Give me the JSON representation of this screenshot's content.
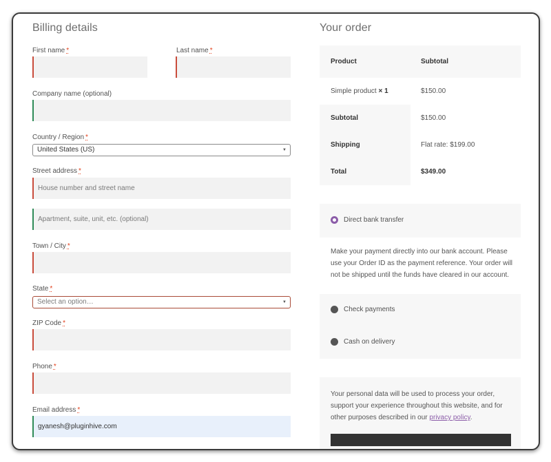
{
  "billing": {
    "heading": "Billing details",
    "required_mark": "*",
    "first_name_label": "First name",
    "last_name_label": "Last name",
    "company_label": "Company name (optional)",
    "country_label": "Country / Region",
    "country_value": "United States (US)",
    "street_label": "Street address",
    "street_placeholder": "House number and street name",
    "apartment_placeholder": "Apartment, suite, unit, etc. (optional)",
    "city_label": "Town / City",
    "state_label": "State",
    "state_placeholder": "Select an option…",
    "zip_label": "ZIP Code",
    "phone_label": "Phone",
    "email_label": "Email address",
    "email_value": "gyanesh@pluginhive.com"
  },
  "order": {
    "heading": "Your order",
    "col_product": "Product",
    "col_subtotal": "Subtotal",
    "item_name": "Simple product",
    "item_qty": "× 1",
    "item_price": "$150.00",
    "subtotal_label": "Subtotal",
    "subtotal_value": "$150.00",
    "shipping_label": "Shipping",
    "shipping_value": "Flat rate: $199.00",
    "total_label": "Total",
    "total_value": "$349.00"
  },
  "payment": {
    "options": [
      "Direct bank transfer",
      "Check payments",
      "Cash on delivery"
    ],
    "selected": "Direct bank transfer",
    "description": "Make your payment directly into our bank account. Please use your Order ID as the payment reference. Your order will not be shipped until the funds have cleared in our account."
  },
  "privacy": {
    "text_before": "Your personal data will be used to process your order, support your experience throughout this website, and for other purposes described in our ",
    "link_text": "privacy policy",
    "text_after": "."
  },
  "colors": {
    "accent": "#8b5ca8",
    "required": "#e2401c",
    "invalid_border": "#c94b3b",
    "valid_border": "#2e8b57"
  }
}
